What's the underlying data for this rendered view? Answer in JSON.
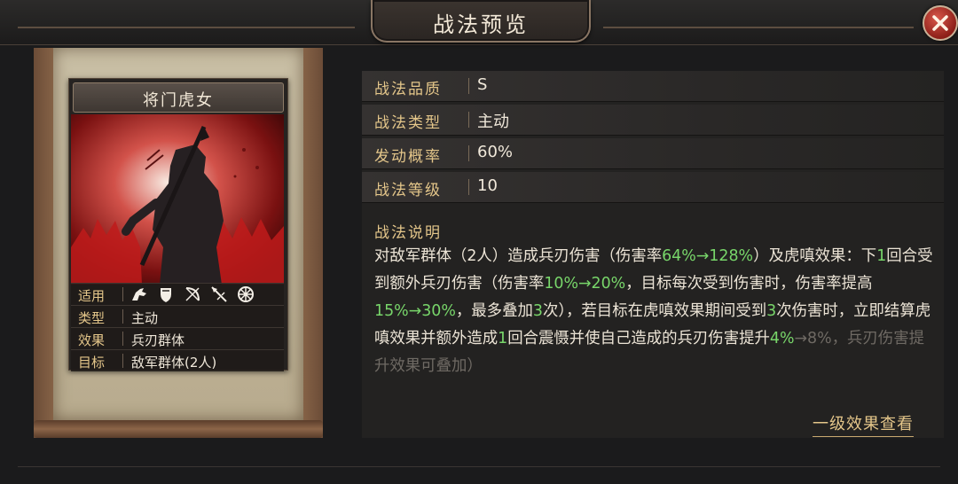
{
  "header": {
    "title": "战法预览",
    "close_label": "close"
  },
  "card": {
    "name": "将门虎女",
    "rows": [
      {
        "key": "适用",
        "value": "",
        "icons": [
          "cavalry-icon",
          "shield-icon",
          "bow-icon",
          "spear-icon",
          "wheel-icon"
        ]
      },
      {
        "key": "类型",
        "value": "主动"
      },
      {
        "key": "效果",
        "value": "兵刃群体"
      },
      {
        "key": "目标",
        "value": "敌军群体(2人)"
      }
    ]
  },
  "info": {
    "rows": [
      {
        "key": "战法品质",
        "value": "S"
      },
      {
        "key": "战法类型",
        "value": "主动"
      },
      {
        "key": "发动概率",
        "value": "60%"
      },
      {
        "key": "战法等级",
        "value": "10"
      }
    ],
    "desc_title": "战法说明",
    "desc_segments": [
      {
        "t": "对敌军群体（2人）造成兵刃伤害（伤害率",
        "c": ""
      },
      {
        "t": "64%→128%",
        "c": "g"
      },
      {
        "t": "）及虎嗔效果：下",
        "c": ""
      },
      {
        "t": "1",
        "c": "g"
      },
      {
        "t": "回合受到额外兵刃伤害（伤害率",
        "c": ""
      },
      {
        "t": "10%→20%",
        "c": "g"
      },
      {
        "t": "，目标每次受到伤害时，伤害率提高",
        "c": ""
      },
      {
        "t": "15%→30%",
        "c": "g"
      },
      {
        "t": "，最多叠加",
        "c": ""
      },
      {
        "t": "3",
        "c": "g"
      },
      {
        "t": "次），若目标在虎嗔效果期间受到",
        "c": ""
      },
      {
        "t": "3",
        "c": "g"
      },
      {
        "t": "次伤害时，立即结算虎嗔效果并额外造成",
        "c": ""
      },
      {
        "t": "1",
        "c": "g"
      },
      {
        "t": "回合震慑并使自己造成的兵刃伤害提升",
        "c": ""
      },
      {
        "t": "4%",
        "c": "g"
      },
      {
        "t": "→8%，兵刃伤害提升效果可叠加）",
        "c": "fade"
      }
    ],
    "level_link": "一级效果查看"
  }
}
